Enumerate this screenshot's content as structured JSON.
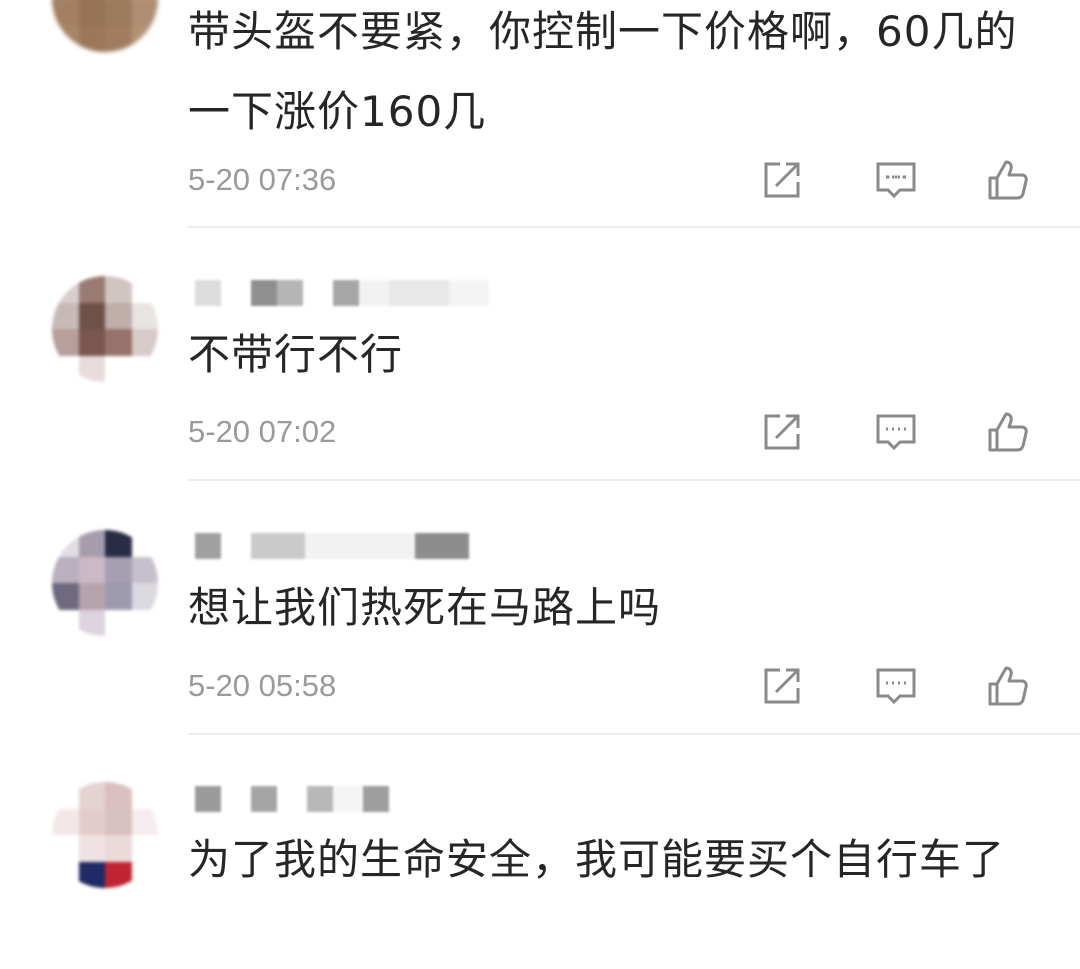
{
  "comments": [
    {
      "text": "带头盔不要紧，你控制一下价格啊，60几的一下涨价160几",
      "time": "5-20 07:36",
      "has_user": false
    },
    {
      "text": "不带行不行",
      "time": "5-20 07:02",
      "has_user": true
    },
    {
      "text": "想让我们热死在马路上吗",
      "time": "5-20 05:58",
      "has_user": true
    },
    {
      "text": "为了我的生命安全，我可能要买个自行车了",
      "time": "",
      "has_user": true
    }
  ],
  "icons": {
    "share": "share-icon",
    "reply": "reply-icon",
    "like": "thumbs-up-icon"
  },
  "colors": {
    "text": "#262626",
    "meta": "#9a9a9a",
    "icon": "#8a8a8a",
    "divider": "#ececec"
  }
}
